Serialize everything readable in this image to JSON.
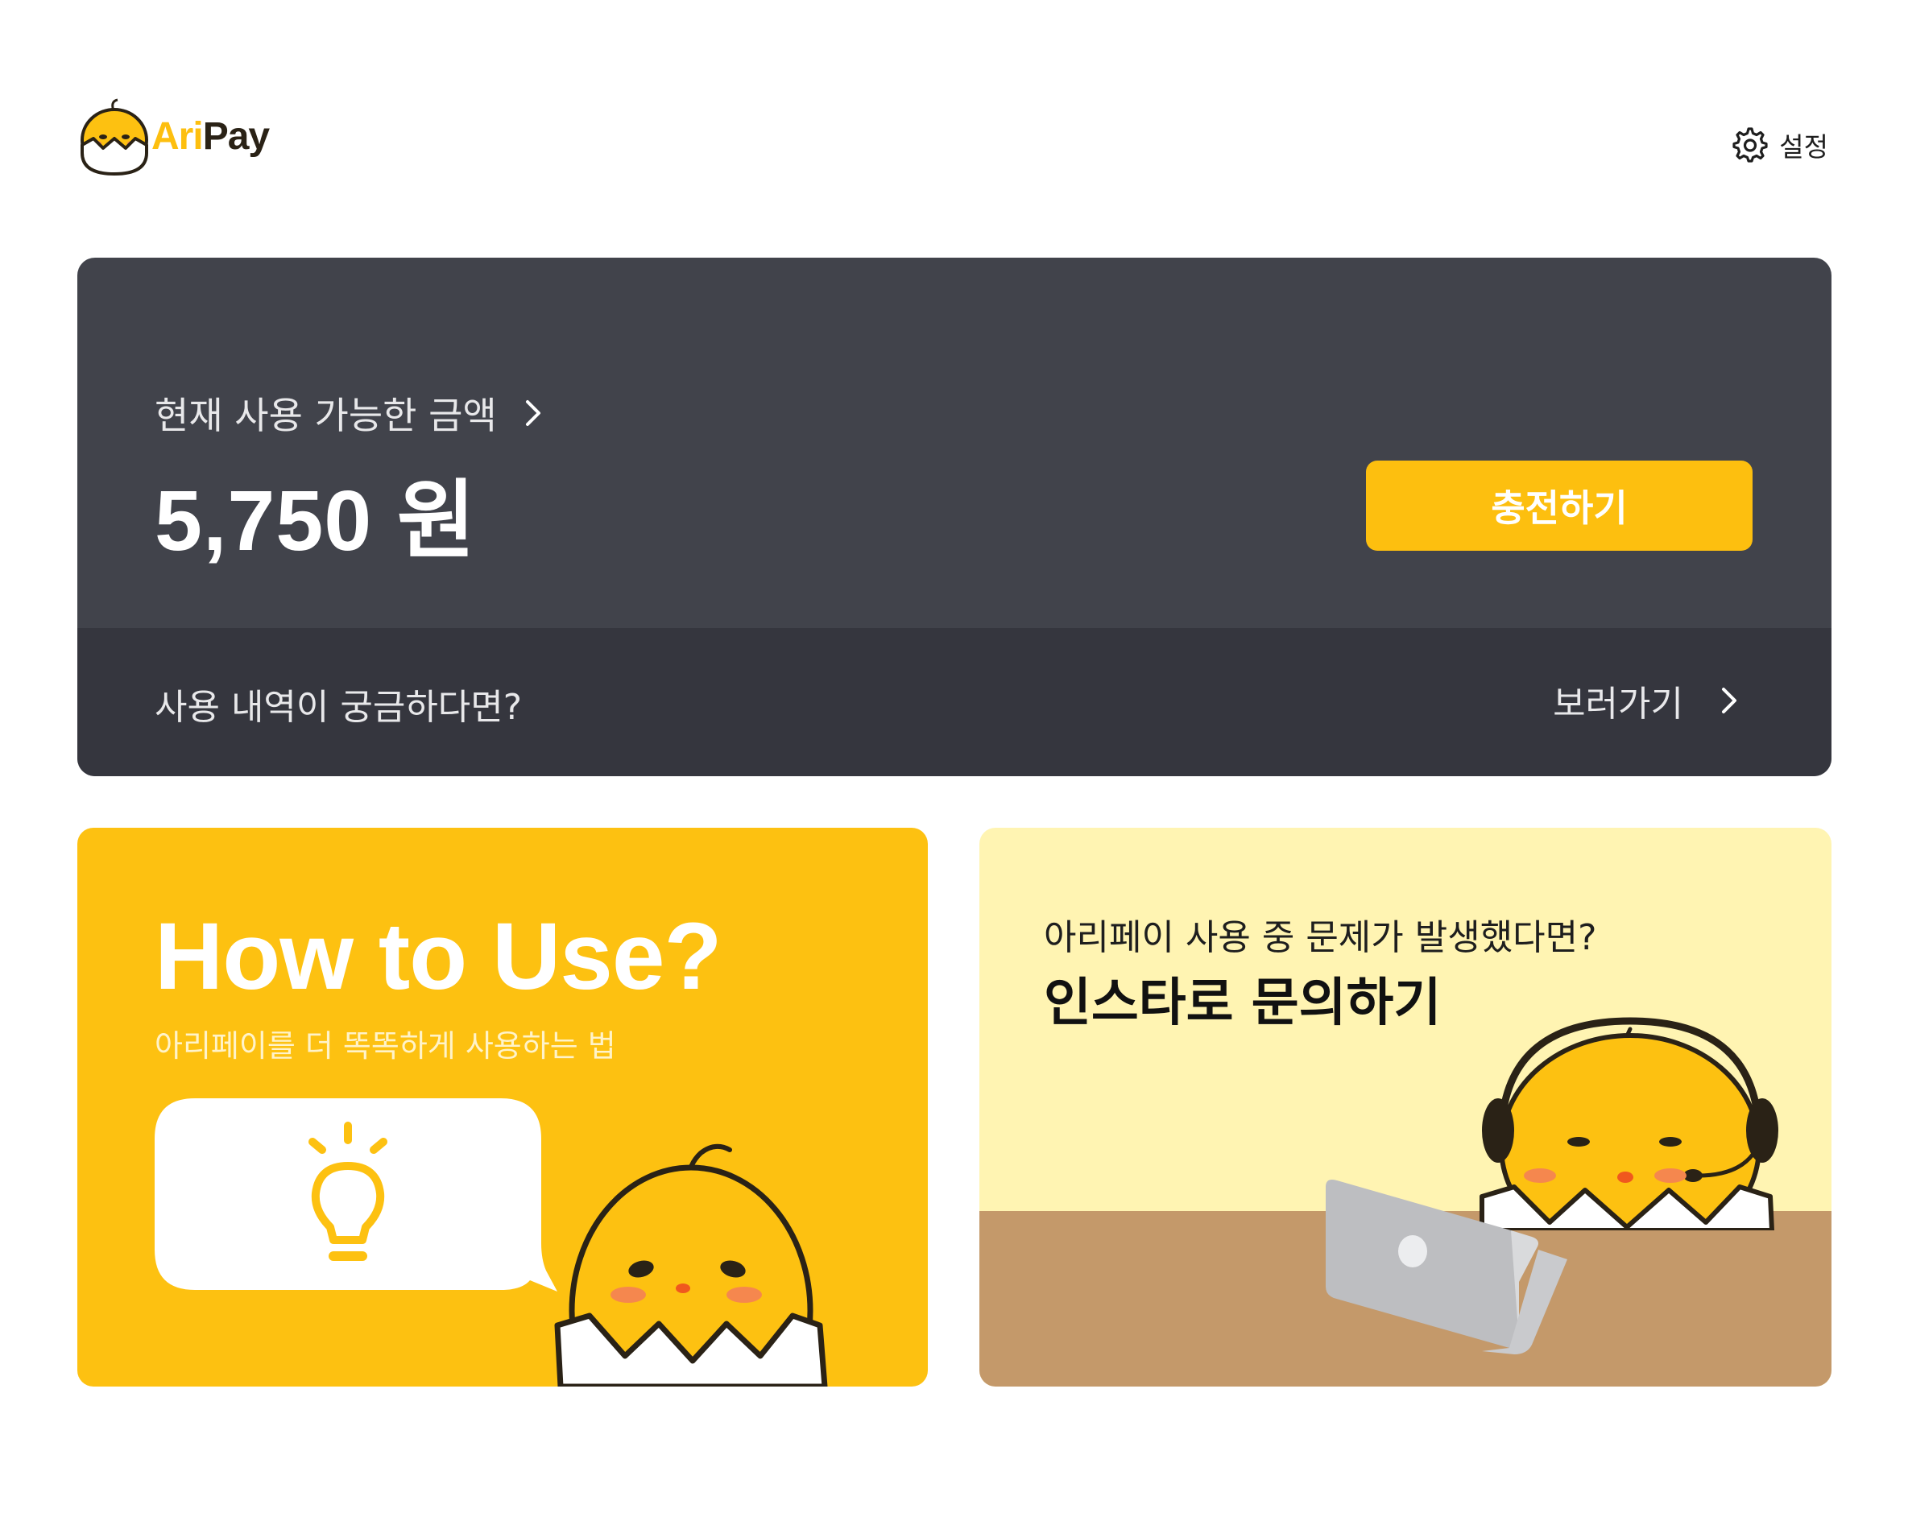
{
  "app": {
    "brand_part1": "Ari",
    "brand_part2": "Pay"
  },
  "header": {
    "settings_label": "설정",
    "settings_icon": "gear-icon"
  },
  "balance": {
    "label": "현재 사용 가능한 금액",
    "amount": "5,750 원",
    "charge_button": "충전하기",
    "history_question": "사용 내역이 궁금하다면?",
    "history_link": "보러가기"
  },
  "cards": {
    "how_to_use": {
      "title": "How to Use?",
      "subtitle": "아리페이를 더 똑똑하게 사용하는 법",
      "icon": "lightbulb-icon"
    },
    "inquiry": {
      "subtitle": "아리페이 사용 중 문제가 발생했다면?",
      "title": "인스타로 문의하기"
    }
  },
  "colors": {
    "accent_yellow": "#FDBF0F",
    "card_dark": "#41434B",
    "card_dark_bottom": "#35363E",
    "inquiry_bg": "#FFF4B2",
    "desk": "#C4996A"
  }
}
